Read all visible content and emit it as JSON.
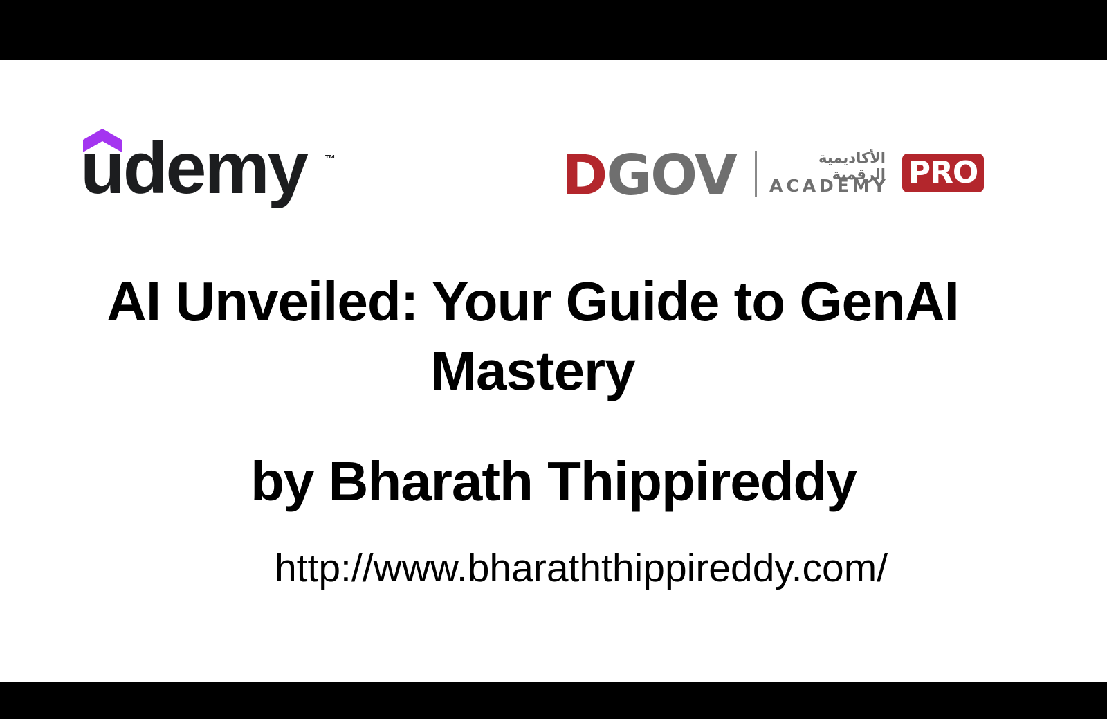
{
  "logos": {
    "udemy": {
      "wordmark": "udemy",
      "trademark": "™",
      "icon": "udemy-house-icon",
      "accent_color": "#a435f0",
      "text_color": "#1c1d1f"
    },
    "dgov": {
      "letter_d": "D",
      "letters_rest": "GOV",
      "arabic_text": "الأكاديمية الرقمية",
      "academy_text": "ACADEMY",
      "badge_text": "PRO",
      "red_color": "#b3262c",
      "gray_color": "#6f6f6f"
    }
  },
  "slide": {
    "title_line1": "AI Unveiled: Your Guide to GenAI",
    "title_line2": "Mastery",
    "author": "by Bharath Thippireddy",
    "url": "http://www.bharaththippireddy.com/"
  }
}
